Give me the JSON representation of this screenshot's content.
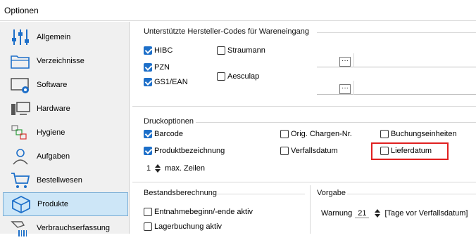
{
  "window": {
    "title": "Optionen"
  },
  "sidebar": {
    "items": [
      {
        "label": "Allgemein",
        "icon": "sliders-icon"
      },
      {
        "label": "Verzeichnisse",
        "icon": "folder-icon"
      },
      {
        "label": "Software",
        "icon": "software-gear-icon"
      },
      {
        "label": "Hardware",
        "icon": "computer-icon"
      },
      {
        "label": "Hygiene",
        "icon": "hygiene-icon"
      },
      {
        "label": "Aufgaben",
        "icon": "tasks-person-icon"
      },
      {
        "label": "Bestellwesen",
        "icon": "cart-icon"
      },
      {
        "label": "Produkte",
        "icon": "cube-icon",
        "selected": true
      },
      {
        "label": "Verbrauchserfassung",
        "icon": "barcode-scan-icon"
      }
    ]
  },
  "codes": {
    "title": "Unterstützte Hersteller-Codes für Wareneingang",
    "hibc": {
      "label": "HIBC",
      "checked": true
    },
    "straumann": {
      "label": "Straumann",
      "checked": false
    },
    "pzn": {
      "label": "PZN",
      "checked": true
    },
    "aesculap": {
      "label": "Aesculap",
      "checked": false
    },
    "gs1": {
      "label": "GS1/EAN",
      "checked": true
    },
    "browse_label": "···"
  },
  "print": {
    "title": "Druckoptionen",
    "barcode": {
      "label": "Barcode",
      "checked": true
    },
    "orig_charge": {
      "label": "Orig. Chargen-Nr.",
      "checked": false
    },
    "buchung": {
      "label": "Buchungseinheiten",
      "checked": false
    },
    "produktbez": {
      "label": "Produktbezeichnung",
      "checked": true
    },
    "verfall": {
      "label": "Verfallsdatum",
      "checked": false
    },
    "lieferdatum": {
      "label": "Lieferdatum",
      "checked": false
    },
    "max_lines_value": "1",
    "max_lines_label": "max. Zeilen"
  },
  "stock": {
    "title": "Bestandsberechnung",
    "entnahme": {
      "label": "Entnahmebeginn/-ende aktiv",
      "checked": false
    },
    "lager": {
      "label": "Lagerbuchung aktiv",
      "checked": false
    }
  },
  "defaults": {
    "title": "Vorgabe",
    "warning_label": "Warnung",
    "warning_value": "21",
    "warning_unit": "[Tage vor Verfallsdatum]"
  },
  "colors": {
    "accent": "#1d6fc9",
    "highlight": "#e02020",
    "selected_bg": "#cde6f7"
  }
}
